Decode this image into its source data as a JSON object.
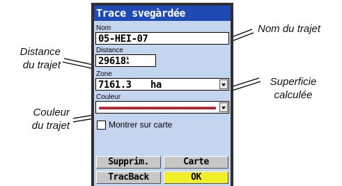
{
  "window": {
    "title": "Trace svegàrdée"
  },
  "fields": {
    "name": {
      "label": "Nom",
      "value": "05-HEI-07"
    },
    "distance": {
      "label": "Distance",
      "value": "29618",
      "unit_top": "k",
      "unit_bottom": "m"
    },
    "zone": {
      "label": "Zone",
      "value": "7161.3",
      "unit": "ha"
    },
    "color": {
      "label": "Couleur",
      "value_color": "#b51e2a"
    }
  },
  "show_on_map": {
    "label": "Montrer sur carte",
    "checked": false
  },
  "buttons": {
    "delete": "Supprim.",
    "map": "Carte",
    "tracback": "TracBack",
    "ok": "OK"
  },
  "annotations": {
    "name": "Nom du trajet",
    "distance_line1": "Distance",
    "distance_line2": "du trajet",
    "area_line1": "Superficie",
    "area_line2": "calculée",
    "color_line1": "Couleur",
    "color_line2": "du trajet"
  },
  "colors": {
    "titlebar": "#1f49b3",
    "screen_bg": "#c4d6ef",
    "ok_button": "#f2ee27"
  }
}
